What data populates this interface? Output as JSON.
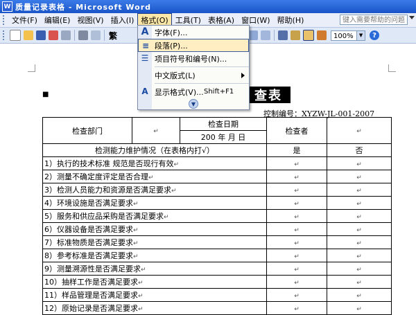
{
  "window": {
    "title": "质量记录表格 - Microsoft Word",
    "app_icon": "W"
  },
  "menubar": {
    "items": [
      "文件(F)",
      "编辑(E)",
      "视图(V)",
      "插入(I)",
      "格式(O)",
      "工具(T)",
      "表格(A)",
      "窗口(W)",
      "帮助(H)"
    ],
    "active_index": 4,
    "help_placeholder": "键入需要帮助的问题"
  },
  "toolbar": {
    "font_button": "繁",
    "zoom": "100%"
  },
  "format_menu": {
    "items": [
      {
        "label": "字体(F)...",
        "icon": "font-A-icon"
      },
      {
        "label": "段落(P)...",
        "icon": "paragraph-icon",
        "highlighted": true
      },
      {
        "label": "项目符号和编号(N)...",
        "icon": "bullets-numbering-icon"
      },
      {
        "label": "中文版式(L)",
        "submenu": true
      },
      {
        "label": "显示格式(V)...",
        "shortcut": "Shift+F1",
        "icon": "reveal-format-icon"
      }
    ]
  },
  "document": {
    "heading_fragment": "查表",
    "control_number": "控制编号：XYZW-JL-001-2007",
    "table": {
      "header": {
        "department_label": "检查部门",
        "date_label": "检查日期",
        "date_value": "200   年   月   日",
        "inspector_label": "检查者"
      },
      "section_title": "检测能力维护情况（在表格内打√）",
      "yes_label": "是",
      "no_label": "否",
      "rows": [
        "1）执行的技术标准 规范是否现行有效",
        "2）测量不确定度评定是否合理",
        "3）检测人员能力和资源是否满足要求",
        "4）环境设施是否满足要求",
        "5）服务和供应品采购是否满足要求",
        "6）仪器设备是否满足要求",
        "7）标准物质是否满足要求",
        "8）参考标准是否满足要求",
        "9）测量溯源性是否满足要求",
        "10）抽样工作是否满足要求",
        "11）样品管理是否满足要求",
        "12）原始记录是否满足要求"
      ]
    }
  },
  "colors": {
    "titlebar": "#1a54c8",
    "menu_highlight": "#ffeec2",
    "toolbar": "#dfe8f6"
  }
}
